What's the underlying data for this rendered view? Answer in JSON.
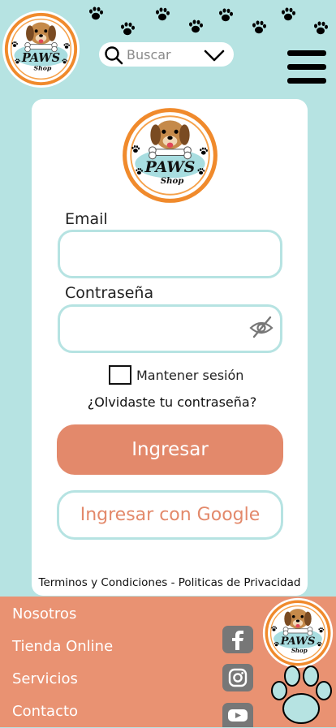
{
  "header": {
    "search_placeholder": "Buscar",
    "logo_text": "PAWS",
    "logo_subtext": "Shop"
  },
  "login": {
    "email_label": "Email",
    "password_label": "Contraseña",
    "remember_label": "Mantener sesión",
    "forgot_label": "¿Olvidaste tu contraseña?",
    "submit_label": "Ingresar",
    "google_label": "Ingresar con Google",
    "terms_label": "Terminos y Condiciones - Politicas de Privacidad"
  },
  "footer": {
    "links": [
      "Nosotros",
      "Tienda Online",
      "Servicios",
      "Contacto"
    ]
  },
  "colors": {
    "background": "#b6e3e2",
    "accent": "#e3896b",
    "footer": "#e99272"
  }
}
